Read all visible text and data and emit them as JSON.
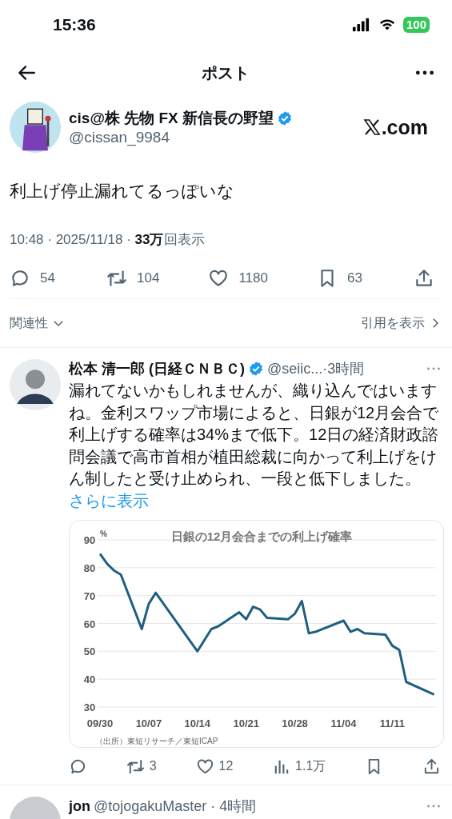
{
  "status_bar": {
    "time": "15:36",
    "battery": "100"
  },
  "header": {
    "title": "ポスト"
  },
  "post": {
    "author": {
      "name": "cis@株 先物 FX 新信長の野望",
      "verified": true,
      "handle": "@cissan_9984"
    },
    "source": ".com",
    "text": "利上げ停止漏れてるっぽいな",
    "meta": "10:48 · 2025/11/18 · **33万**回表示",
    "actions": [
      {
        "kind": "reply",
        "count": "54"
      },
      {
        "kind": "repost",
        "count": "104"
      },
      {
        "kind": "like",
        "count": "1180"
      },
      {
        "kind": "bookmark",
        "count": "63"
      },
      {
        "kind": "share"
      }
    ]
  },
  "replies_bar": {
    "sort": "関連性",
    "quotes": "引用を表示"
  },
  "replies": [
    {
      "name": "松本 清一郎 (日経ＣＮＢＣ)",
      "verified": true,
      "handle_time": "@seiic...·3時間",
      "text": "漏れてないかもしれませんが、織り込んではいますね。金利スワップ市場によると、日銀が12月会合で利上げする確率は34%まで低下。12日の経済財政諮問会議で高市首相が植田総裁に向かって利上げをけん制したと受け止められ、一段と低下しました。",
      "more": "さらに表示",
      "chart_data": {
        "type": "line",
        "title": "日銀の12月会合までの利上げ確率",
        "ylabel": "%",
        "categories": [
          "09/30",
          null,
          null,
          null,
          null,
          null,
          null,
          "10/07",
          null,
          null,
          null,
          null,
          null,
          null,
          "10/14",
          null,
          null,
          null,
          null,
          null,
          null,
          "10/21",
          null,
          null,
          null,
          null,
          null,
          null,
          "10/28",
          null,
          null,
          null,
          null,
          null,
          null,
          "11/04",
          null,
          null,
          null,
          null,
          null,
          null,
          "11/11",
          null,
          null,
          null,
          null,
          null,
          null
        ],
        "series": [
          {
            "color": "#1f5f7f",
            "values": [
              85,
              81.5,
              79,
              77.5,
              null,
              null,
              58,
              67,
              71,
              null,
              null,
              null,
              null,
              null,
              50,
              null,
              58,
              59,
              null,
              null,
              64,
              61.5,
              66,
              65,
              62,
              null,
              null,
              61.5,
              63.5,
              68,
              56.5,
              57,
              null,
              null,
              null,
              61,
              57,
              58,
              56.5,
              null,
              null,
              56,
              52,
              50.5,
              39,
              null,
              null,
              null,
              34.5
            ]
          }
        ],
        "grid": true,
        "ylim": [
          30,
          90
        ],
        "yticks": [
          30,
          40,
          50,
          60,
          70,
          80,
          90
        ]
      },
      "chart_source": "（出所）東短リサーチ／東短ICAP",
      "actions": [
        {
          "kind": "reply"
        },
        {
          "kind": "repost",
          "count": "3"
        },
        {
          "kind": "like",
          "count": "12"
        },
        {
          "kind": "views",
          "count": "1.1万"
        },
        {
          "kind": "bookmark"
        },
        {
          "kind": "share"
        }
      ]
    },
    {
      "name": "jon",
      "handle_time": "@tojogakuMaster · 4時間"
    }
  ]
}
